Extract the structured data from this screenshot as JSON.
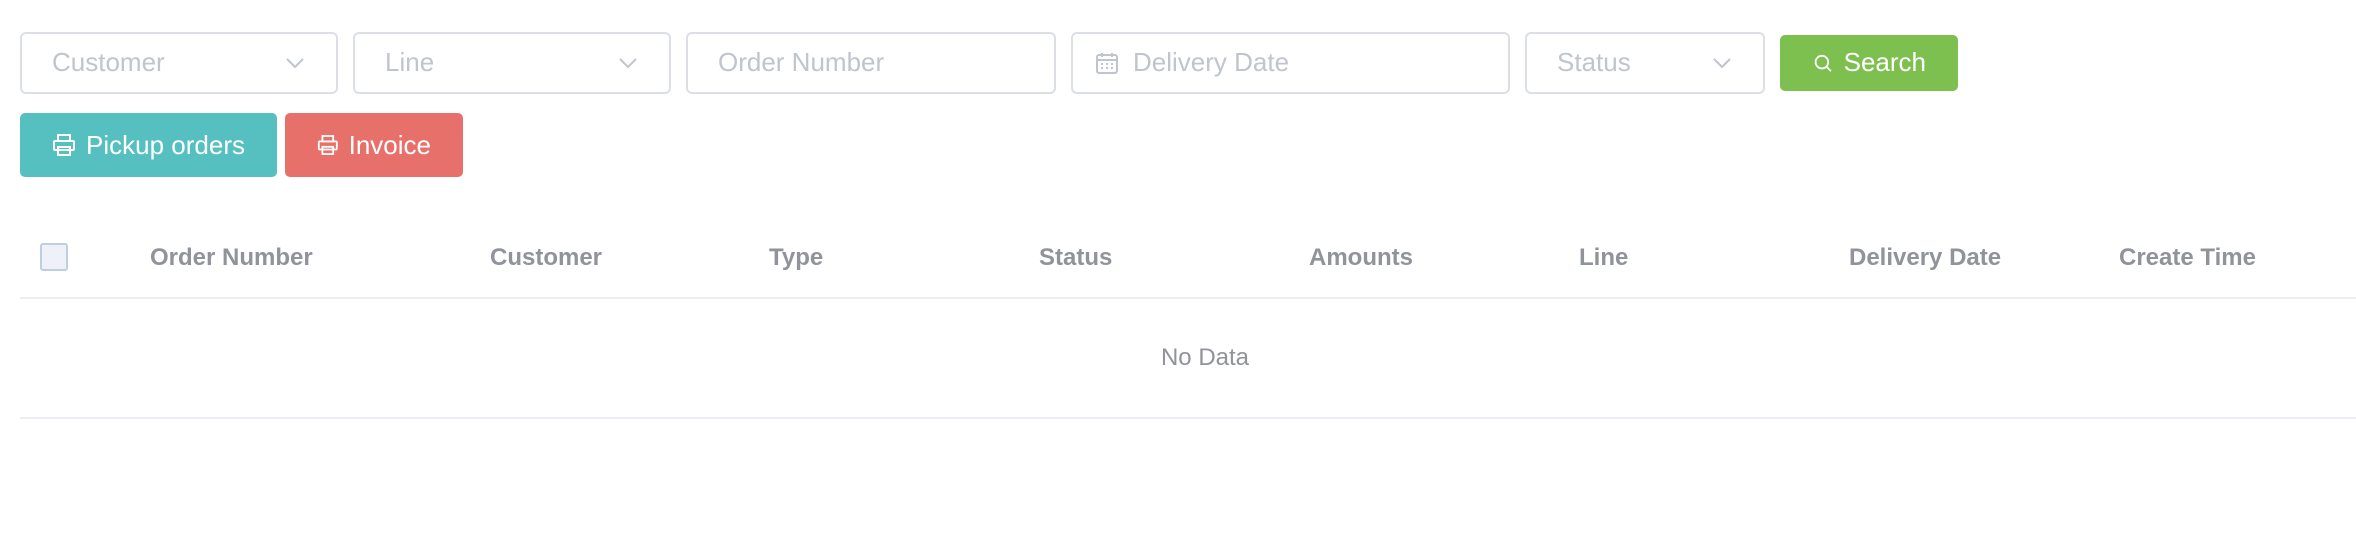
{
  "filters": {
    "customer_placeholder": "Customer",
    "line_placeholder": "Line",
    "order_number_placeholder": "Order Number",
    "delivery_date_placeholder": "Delivery Date",
    "status_placeholder": "Status",
    "search_label": "Search"
  },
  "actions": {
    "pickup_label": "Pickup orders",
    "invoice_label": "Invoice"
  },
  "table": {
    "columns": [
      "Order Number",
      "Customer",
      "Type",
      "Status",
      "Amounts",
      "Line",
      "Delivery Date",
      "Create Time"
    ],
    "empty_text": "No Data"
  },
  "colors": {
    "search": "#7ec050",
    "pickup": "#56c0c1",
    "invoice": "#e8706a"
  },
  "icons": {
    "select": "chevron-down-icon",
    "date": "calendar-icon",
    "search": "search-icon",
    "print": "printer-icon"
  }
}
